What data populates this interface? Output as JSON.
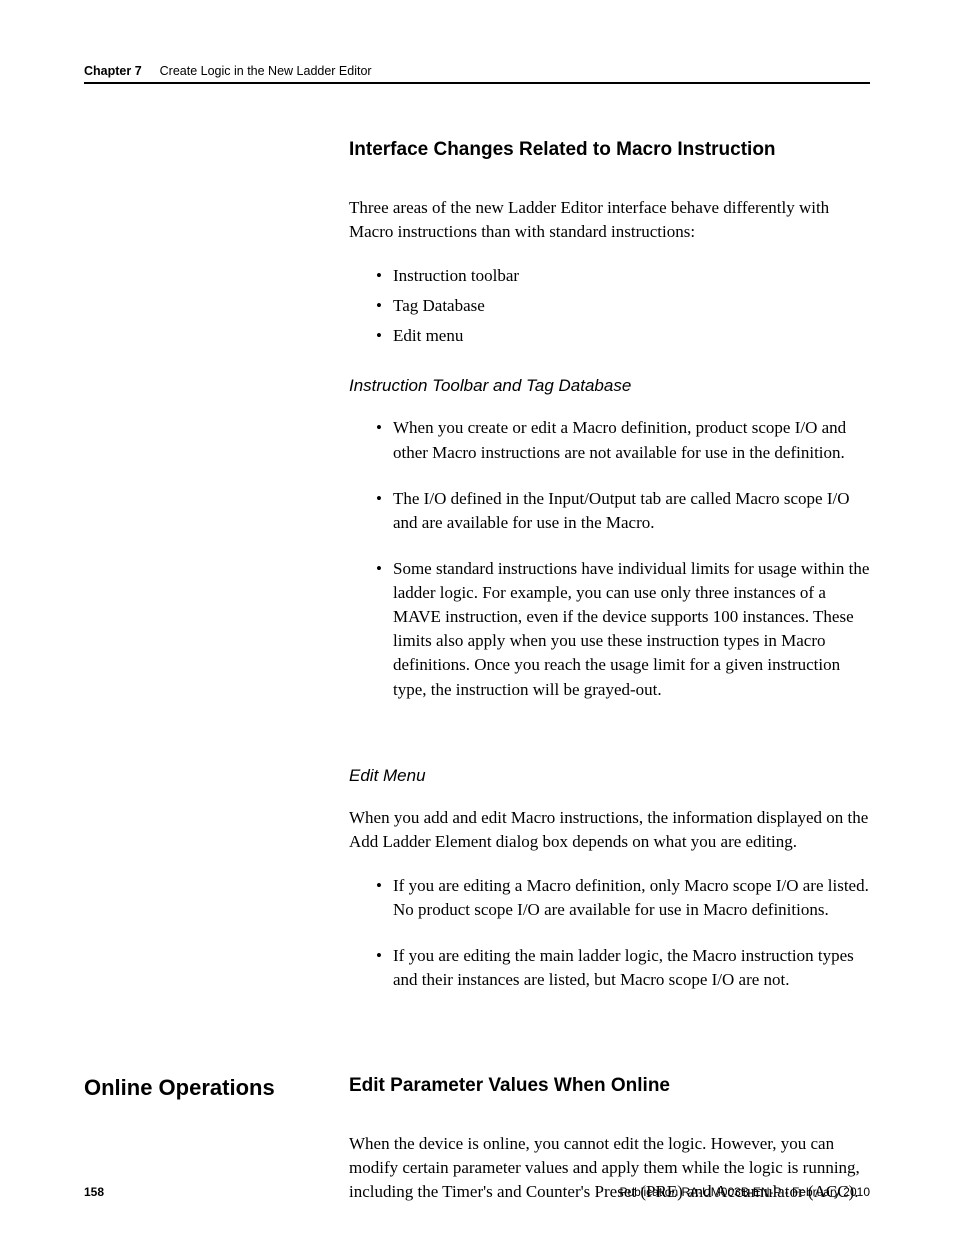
{
  "header": {
    "chapter": "Chapter 7",
    "title": "Create Logic in the New Ladder Editor"
  },
  "section1": {
    "heading": "Interface Changes Related to Macro Instruction",
    "intro": "Three areas of the new Ladder Editor interface behave differently with Macro instructions than with standard instructions:",
    "areas": [
      "Instruction toolbar",
      "Tag Database",
      "Edit menu"
    ],
    "sub1": {
      "heading": "Instruction Toolbar and Tag Database",
      "bullets": [
        "When you create or edit a Macro definition, product scope I/O and other Macro instructions are not available for use in the definition.",
        "The I/O defined in the Input/Output tab are called Macro scope I/O and are available for use in the Macro.",
        "Some standard instructions have individual limits for usage within the ladder logic. For example, you can use only three instances of a MAVE instruction, even if the device supports 100 instances. These limits also apply when you use these instruction types in Macro definitions. Once you reach the usage limit for a given instruction type, the instruction will be grayed-out."
      ]
    },
    "sub2": {
      "heading": "Edit Menu",
      "intro": "When you add and edit Macro instructions, the information displayed on the Add Ladder Element dialog box depends on what you are editing.",
      "bullets": [
        "If you are editing a Macro definition, only Macro scope I/O are listed. No product scope I/O are available for use in Macro definitions.",
        "If you are editing the main ladder logic, the Macro instruction types and their instances are listed, but Macro scope I/O are not."
      ]
    }
  },
  "section2": {
    "side": "Online Operations",
    "heading": "Edit Parameter Values When Online",
    "body": "When the device is online, you cannot edit the logic. However, you can modify certain parameter values and apply them while the logic is running, including the Timer's and Counter's Preset (PRE) and Accumulator (ACC)."
  },
  "footer": {
    "page": "158",
    "pub": "Publication RA-UM003B-EN-P - February 2010"
  }
}
